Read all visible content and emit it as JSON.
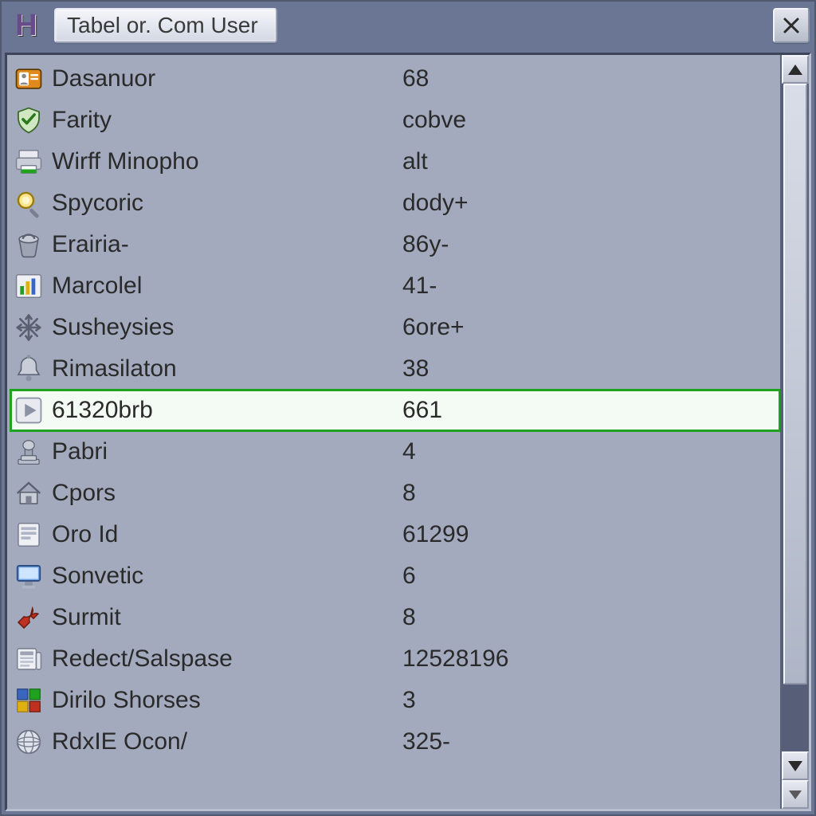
{
  "window": {
    "title": "Tabel or. Com User",
    "app_glyph": "H"
  },
  "rows": [
    {
      "icon": "id-badge-icon",
      "label": "Dasanuor",
      "value": "68",
      "selected": false
    },
    {
      "icon": "shield-check-icon",
      "label": "Farity",
      "value": "cobve",
      "selected": false
    },
    {
      "icon": "printer-icon",
      "label": "Wirff Minopho",
      "value": "alt",
      "selected": false
    },
    {
      "icon": "search-icon",
      "label": "Spycoric",
      "value": "dody+",
      "selected": false
    },
    {
      "icon": "bucket-icon",
      "label": "Erairia-",
      "value": "86y-",
      "selected": false
    },
    {
      "icon": "chart-icon",
      "label": "Marcolel",
      "value": "41-",
      "selected": false
    },
    {
      "icon": "snowflake-icon",
      "label": "Susheysies",
      "value": "6ore+",
      "selected": false
    },
    {
      "icon": "bell-icon",
      "label": "Rimasilaton",
      "value": "38",
      "selected": false
    },
    {
      "icon": "play-icon",
      "label": "61320brb",
      "value": "661",
      "selected": true
    },
    {
      "icon": "stamp-icon",
      "label": "Pabri",
      "value": "4",
      "selected": false
    },
    {
      "icon": "house-icon",
      "label": "Cpors",
      "value": "8",
      "selected": false
    },
    {
      "icon": "form-icon",
      "label": "Oro Id",
      "value": "61299",
      "selected": false
    },
    {
      "icon": "monitor-icon",
      "label": "Sonvetic",
      "value": "6",
      "selected": false
    },
    {
      "icon": "wrench-icon",
      "label": "Surmit",
      "value": "8",
      "selected": false
    },
    {
      "icon": "news-icon",
      "label": "Redect/Salspase",
      "value": "12528196",
      "selected": false
    },
    {
      "icon": "blocks-icon",
      "label": "Dirilo Shorses",
      "value": "3",
      "selected": false
    },
    {
      "icon": "globe-icon",
      "label": "RdxIE Ocon/",
      "value": "325-",
      "selected": false
    }
  ]
}
